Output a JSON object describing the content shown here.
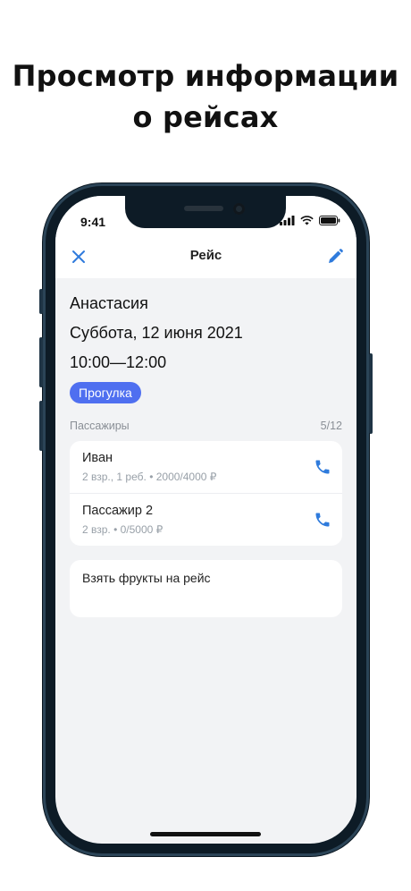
{
  "promo": {
    "line1": "Просмотр информации",
    "line2": "о рейсах"
  },
  "status_bar": {
    "time": "9:41",
    "icons": [
      "signal-icon",
      "wifi-icon",
      "battery-icon"
    ]
  },
  "nav": {
    "title": "Рейс",
    "close_icon": "close-icon",
    "edit_icon": "pencil-icon",
    "accent_color": "#2f7bdc"
  },
  "trip": {
    "client_name": "Анастасия",
    "date": "Суббота, 12 июня 2021",
    "time_range": "10:00—12:00",
    "tag": "Прогулка",
    "tag_color": "#4f6ff0"
  },
  "passengers": {
    "title": "Пассажиры",
    "count": "5/12",
    "items": [
      {
        "name": "Иван",
        "meta": "2 взр., 1 реб. • 2000/4000 ₽"
      },
      {
        "name": "Пассажир 2",
        "meta": "2 взр. • 0/5000 ₽"
      }
    ]
  },
  "note": {
    "text": "Взять фрукты на рейс"
  }
}
